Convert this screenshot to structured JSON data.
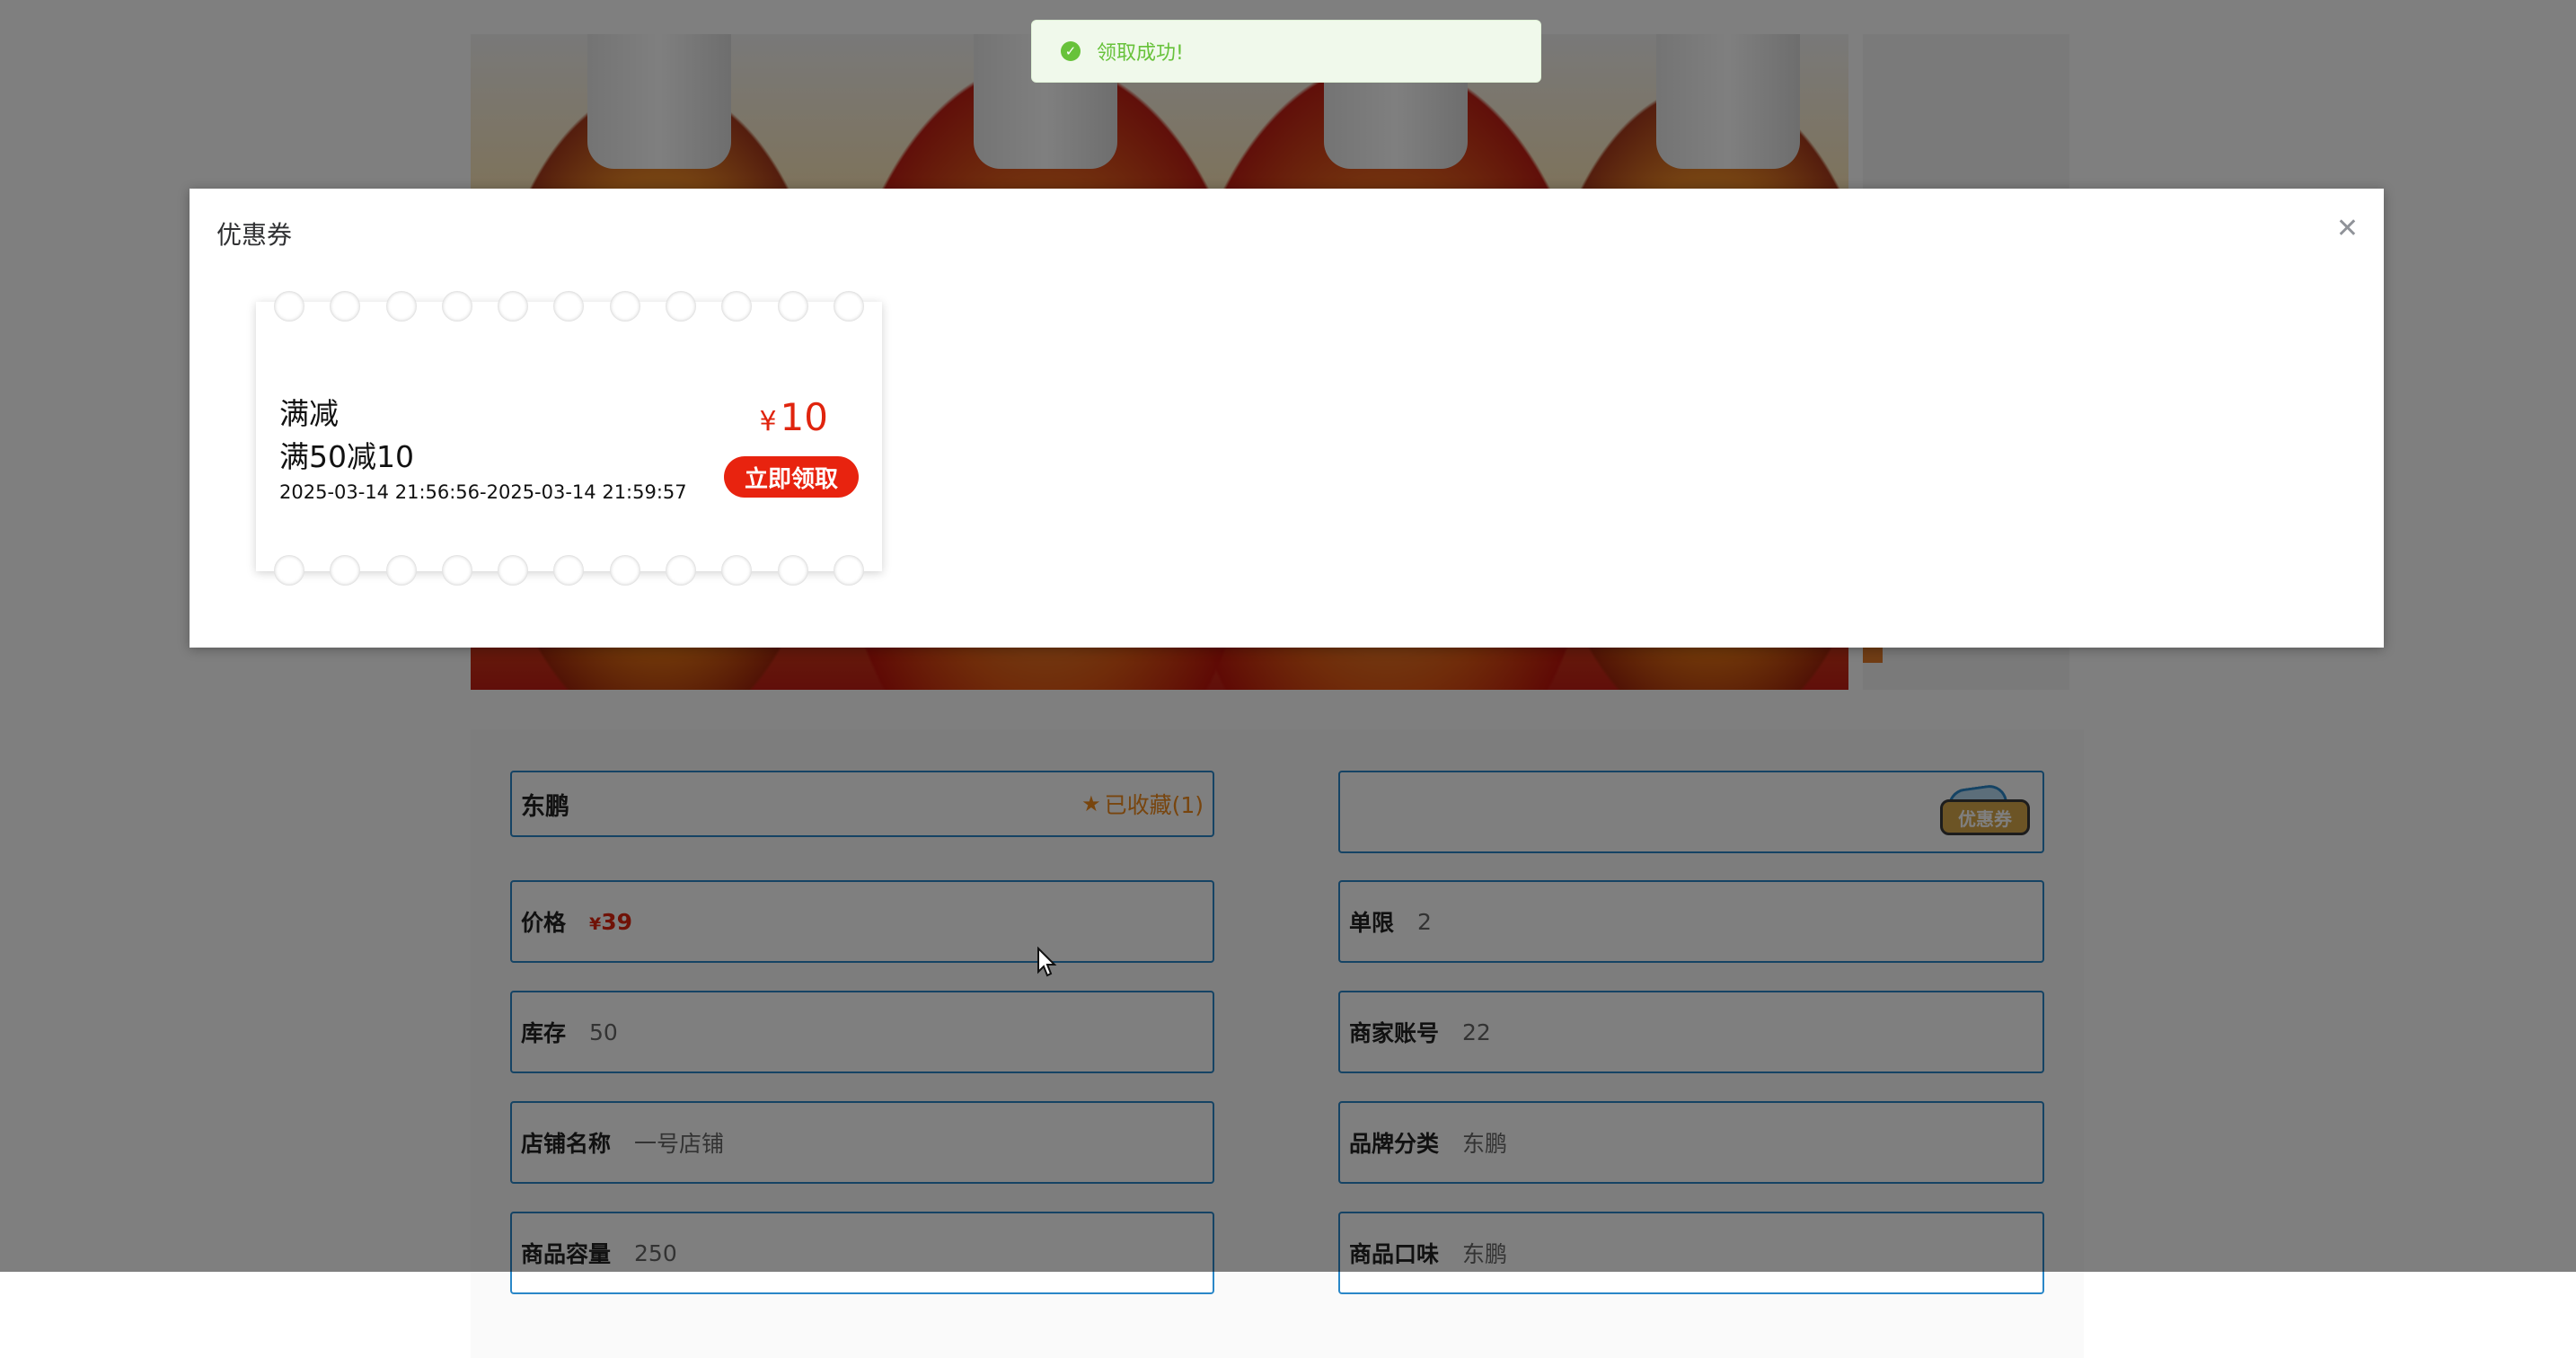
{
  "toast": {
    "message": "领取成功!"
  },
  "dialog": {
    "title": "优惠券",
    "close_icon": "close-icon"
  },
  "coupon": {
    "type": "满减",
    "description": "满50减10",
    "validity": "2025-03-14 21:56:56-2025-03-14 21:59:57",
    "currency": "¥",
    "amount": "10",
    "claim_label": "立即领取"
  },
  "product": {
    "name": "东鹏",
    "favorite_label": "已收藏(1)",
    "coupon_badge_label": "优惠券",
    "fields": {
      "price_label": "价格",
      "price_currency": "¥",
      "price_value": "39",
      "limit_label": "单限",
      "limit_value": "2",
      "stock_label": "库存",
      "stock_value": "50",
      "merchant_account_label": "商家账号",
      "merchant_account_value": "22",
      "shop_name_label": "店铺名称",
      "shop_name_value": "一号店铺",
      "brand_label": "品牌分类",
      "brand_value": "东鹏",
      "capacity_label": "商品容量",
      "capacity_value": "250",
      "flavor_label": "商品口味",
      "flavor_value": "东鹏"
    }
  },
  "colors": {
    "accent": "#2a87c8",
    "price_red": "#e0240e",
    "favorite_orange": "#f08a1c",
    "success_green": "#67c23a"
  }
}
